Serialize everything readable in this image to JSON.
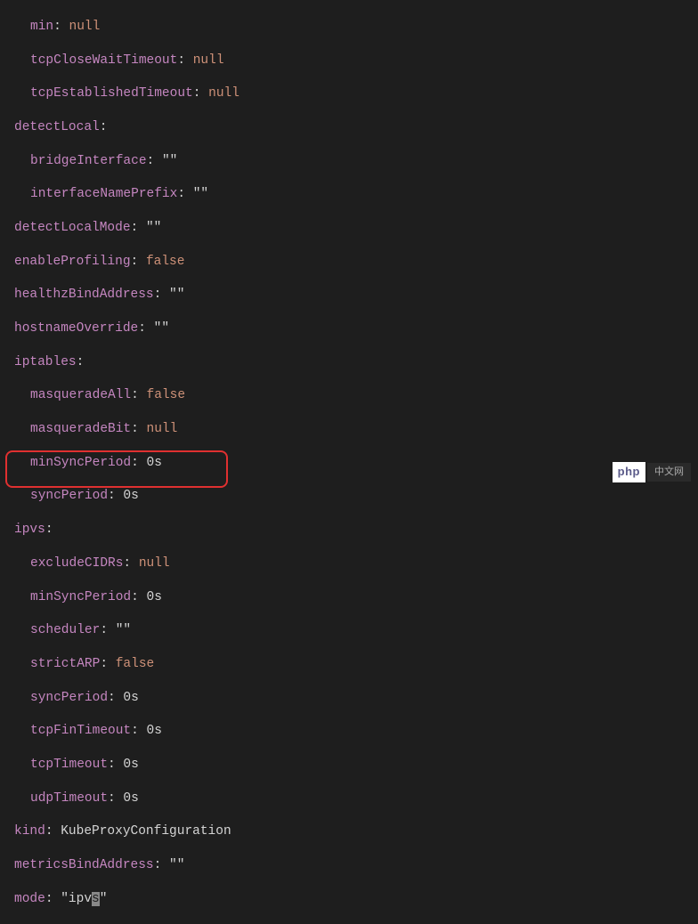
{
  "code": {
    "l1": {
      "k": "min",
      "v": "null"
    },
    "l2": {
      "k": "tcpCloseWaitTimeout",
      "v": "null"
    },
    "l3": {
      "k": "tcpEstablishedTimeout",
      "v": "null"
    },
    "l4": {
      "k": "detectLocal",
      "v": ":"
    },
    "l5": {
      "k": "bridgeInterface",
      "v": "\"\""
    },
    "l6": {
      "k": "interfaceNamePrefix",
      "v": "\"\""
    },
    "l7": {
      "k": "detectLocalMode",
      "v": "\"\""
    },
    "l8": {
      "k": "enableProfiling",
      "v": "false"
    },
    "l9": {
      "k": "healthzBindAddress",
      "v": "\"\""
    },
    "l10": {
      "k": "hostnameOverride",
      "v": "\"\""
    },
    "l11": {
      "k": "iptables",
      "v": ":"
    },
    "l12": {
      "k": "masqueradeAll",
      "v": "false"
    },
    "l13": {
      "k": "masqueradeBit",
      "v": "null"
    },
    "l14": {
      "k": "minSyncPeriod",
      "v": "0s"
    },
    "l15": {
      "k": "syncPeriod",
      "v": "0s"
    },
    "l16": {
      "k": "ipvs",
      "v": ":"
    },
    "l17": {
      "k": "excludeCIDRs",
      "v": "null"
    },
    "l18": {
      "k": "minSyncPeriod",
      "v": "0s"
    },
    "l19": {
      "k": "scheduler",
      "v": "\"\""
    },
    "l20": {
      "k": "strictARP",
      "v": "false"
    },
    "l21": {
      "k": "syncPeriod",
      "v": "0s"
    },
    "l22": {
      "k": "tcpFinTimeout",
      "v": "0s"
    },
    "l23": {
      "k": "tcpTimeout",
      "v": "0s"
    },
    "l24": {
      "k": "udpTimeout",
      "v": "0s"
    },
    "l25": {
      "k": "kind",
      "v": "KubeProxyConfiguration"
    },
    "l26": {
      "k": "metricsBindAddress",
      "v": "\"\""
    },
    "l27": {
      "k": "mode",
      "pre": "\"ipv",
      "cur": "s",
      "post": "\""
    }
  },
  "logo": {
    "php": "php",
    "cn": "中文网"
  }
}
